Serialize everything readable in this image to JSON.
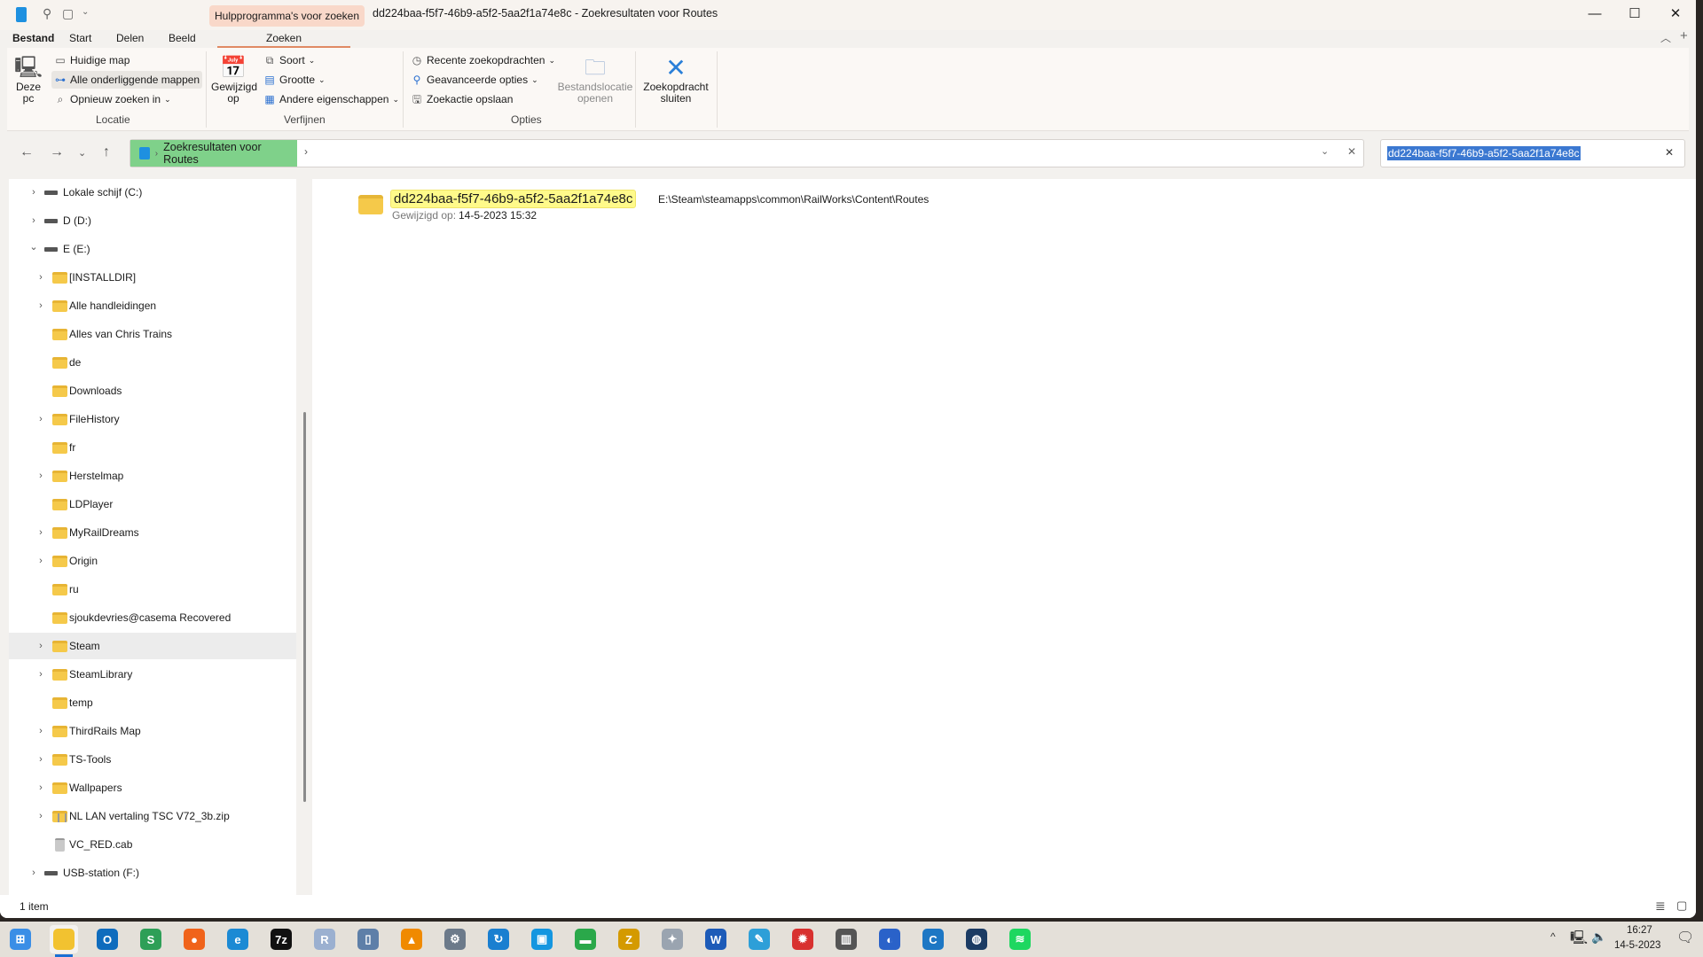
{
  "window": {
    "title": "dd224baa-f5f7-46b9-a5f2-5aa2f1a74e8c - Zoekresultaten voor Routes",
    "context_tab": "Hulpprogramma's voor zoeken"
  },
  "tabs": [
    "Bestand",
    "Start",
    "Delen",
    "Beeld",
    "Zoeken"
  ],
  "ribbon": {
    "locatie": {
      "deze_pc": [
        "Deze",
        "pc"
      ],
      "items": [
        "Huidige map",
        "Alle onderliggende mappen",
        "Opnieuw zoeken in"
      ],
      "group": "Locatie"
    },
    "verfijnen": {
      "gewijzigd": [
        "Gewijzigd",
        "op"
      ],
      "items": [
        "Soort",
        "Grootte",
        "Andere eigenschappen"
      ],
      "group": "Verfijnen"
    },
    "opties": {
      "items": [
        "Recente zoekopdrachten",
        "Geavanceerde opties",
        "Zoekactie opslaan"
      ],
      "bestandslocatie": [
        "Bestandslocatie",
        "openen"
      ],
      "group": "Opties"
    },
    "sluiten": [
      "Zoekopdracht",
      "sluiten"
    ]
  },
  "address": {
    "crumb": "Zoekresultaten voor Routes",
    "search_value": "dd224baa-f5f7-46b9-a5f2-5aa2f1a74e8c"
  },
  "tree": [
    {
      "label": "Lokale schijf (C:)",
      "level": 1,
      "exp": "right",
      "icon": "drive"
    },
    {
      "label": "D (D:)",
      "level": 1,
      "exp": "right",
      "icon": "drive"
    },
    {
      "label": "E (E:)",
      "level": 1,
      "exp": "down",
      "icon": "drive"
    },
    {
      "label": "[INSTALLDIR]",
      "level": 2,
      "exp": "right",
      "icon": "folder"
    },
    {
      "label": "Alle handleidingen",
      "level": 2,
      "exp": "right",
      "icon": "folder"
    },
    {
      "label": "Alles van Chris Trains",
      "level": 2,
      "exp": "",
      "icon": "folder"
    },
    {
      "label": "de",
      "level": 2,
      "exp": "",
      "icon": "folder"
    },
    {
      "label": "Downloads",
      "level": 2,
      "exp": "",
      "icon": "folder"
    },
    {
      "label": "FileHistory",
      "level": 2,
      "exp": "right",
      "icon": "folder"
    },
    {
      "label": "fr",
      "level": 2,
      "exp": "",
      "icon": "folder"
    },
    {
      "label": "Herstelmap",
      "level": 2,
      "exp": "right",
      "icon": "folder"
    },
    {
      "label": "LDPlayer",
      "level": 2,
      "exp": "",
      "icon": "folder"
    },
    {
      "label": "MyRailDreams",
      "level": 2,
      "exp": "right",
      "icon": "folder"
    },
    {
      "label": "Origin",
      "level": 2,
      "exp": "right",
      "icon": "folder"
    },
    {
      "label": "ru",
      "level": 2,
      "exp": "",
      "icon": "folder"
    },
    {
      "label": "sjoukdevries@casema Recovered",
      "level": 2,
      "exp": "",
      "icon": "folder"
    },
    {
      "label": "Steam",
      "level": 2,
      "exp": "right",
      "icon": "folder",
      "highlight": true
    },
    {
      "label": "SteamLibrary",
      "level": 2,
      "exp": "right",
      "icon": "folder"
    },
    {
      "label": "temp",
      "level": 2,
      "exp": "",
      "icon": "folder"
    },
    {
      "label": "ThirdRails Map",
      "level": 2,
      "exp": "right",
      "icon": "folder"
    },
    {
      "label": "TS-Tools",
      "level": 2,
      "exp": "right",
      "icon": "folder"
    },
    {
      "label": "Wallpapers",
      "level": 2,
      "exp": "right",
      "icon": "folder"
    },
    {
      "label": "NL LAN vertaling TSC V72_3b.zip",
      "level": 2,
      "exp": "right",
      "icon": "zip"
    },
    {
      "label": "VC_RED.cab",
      "level": 2,
      "exp": "",
      "icon": "cab"
    },
    {
      "label": "USB-station (F:)",
      "level": 1,
      "exp": "right",
      "icon": "drive"
    }
  ],
  "result": {
    "name": "dd224baa-f5f7-46b9-a5f2-5aa2f1a74e8c",
    "modified_label": "Gewijzigd op:",
    "modified": "14-5-2023 15:32",
    "path": "E:\\Steam\\steamapps\\common\\RailWorks\\Content\\Routes"
  },
  "status": {
    "count": "1 item"
  },
  "taskbar": {
    "apps": [
      {
        "name": "start",
        "color": "#3a8ee6",
        "g": "⊞"
      },
      {
        "name": "file-explorer",
        "color": "#f2c230",
        "g": "",
        "active": true
      },
      {
        "name": "outlook",
        "color": "#0f6cbd",
        "g": "O"
      },
      {
        "name": "chrome-s",
        "color": "#2e9f57",
        "g": "S"
      },
      {
        "name": "firefox",
        "color": "#f0631a",
        "g": "●"
      },
      {
        "name": "edge",
        "color": "#1c8ad4",
        "g": "e"
      },
      {
        "name": "7zip",
        "color": "#111",
        "g": "7z"
      },
      {
        "name": "rail-app",
        "color": "#9bb0d0",
        "g": "R"
      },
      {
        "name": "notepad",
        "color": "#5e7fa8",
        "g": "▯"
      },
      {
        "name": "vlc",
        "color": "#f08a00",
        "g": "▲"
      },
      {
        "name": "settings",
        "color": "#6c7a8a",
        "g": "⚙"
      },
      {
        "name": "sync",
        "color": "#1a7fd0",
        "g": "↻"
      },
      {
        "name": "store",
        "color": "#1496e0",
        "g": "▣"
      },
      {
        "name": "app-flag",
        "color": "#2aa84a",
        "g": "▬"
      },
      {
        "name": "filezilla",
        "color": "#d49a00",
        "g": "Z"
      },
      {
        "name": "tool",
        "color": "#9aa4b0",
        "g": "✦"
      },
      {
        "name": "word",
        "color": "#1d5bb8",
        "g": "W"
      },
      {
        "name": "paint",
        "color": "#2d9fd8",
        "g": "✎"
      },
      {
        "name": "red-app",
        "color": "#d8312f",
        "g": "✹"
      },
      {
        "name": "train",
        "color": "#555",
        "g": "▥"
      },
      {
        "name": "thunderbird",
        "color": "#2a62c9",
        "g": "◐"
      },
      {
        "name": "ccleaner",
        "color": "#1d77c4",
        "g": "C"
      },
      {
        "name": "steam",
        "color": "#1b3b63",
        "g": "◍"
      },
      {
        "name": "spotify",
        "color": "#1ed760",
        "g": "≋"
      }
    ]
  },
  "clock": {
    "time": "16:27",
    "date": "14-5-2023"
  }
}
